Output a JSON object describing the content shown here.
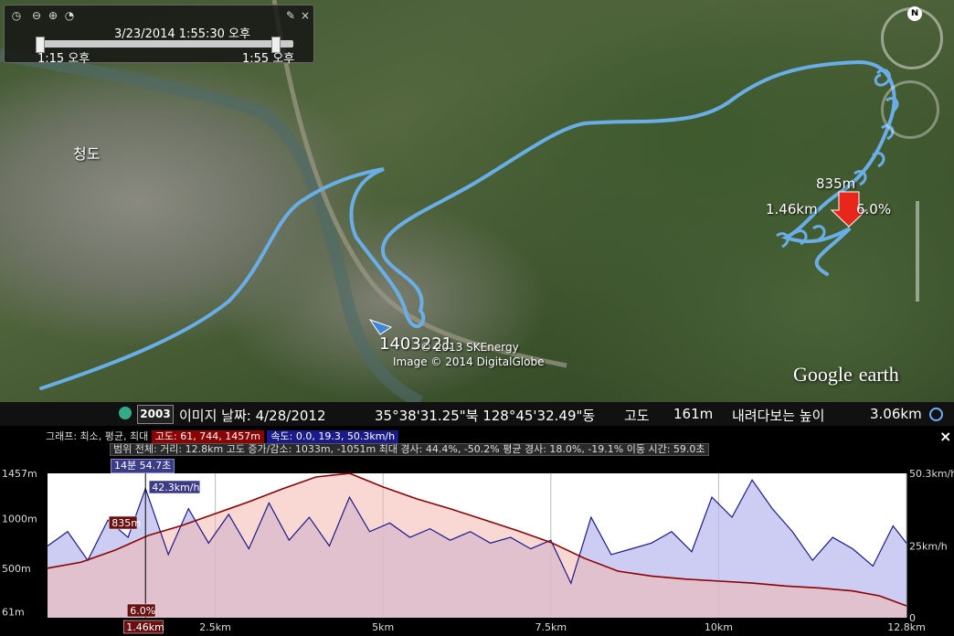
{
  "time_slider": {
    "current": "3/23/2014    1:55:30 오후",
    "start": "1:15 오후",
    "end": "1:55 오후",
    "icons": [
      "clock-icon",
      "zoom-out-icon",
      "zoom-in-icon",
      "settings-icon"
    ]
  },
  "map": {
    "place_label": "청도",
    "marker_elevation": "835m",
    "marker_distance": "1.46km",
    "marker_grade": "6.0%",
    "track_name": "1403221",
    "copyright1": "© 2013 SKEnergy",
    "copyright2": "Image © 2014 DigitalGlobe",
    "track_color": "#5b9bd5",
    "marker_color": "#e8261c",
    "logo_google": "Google",
    "logo_earth": "earth"
  },
  "status_bar": {
    "year": "2003",
    "imagery_date": "이미지 날짜: 4/28/2012",
    "coords": "35°38'31.25\"북 128°45'32.49\"동",
    "elev_label": "고도",
    "elev_value": "161m",
    "eye_label": "내려다보는 높이",
    "eye_value": "3.06km"
  },
  "profile": {
    "legend_prefix": "그래프: 최소, 평균, 최대",
    "legend_elev": "고도: 61, 744, 1457m",
    "legend_speed": "속도: 0.0, 19.3, 50.3km/h",
    "stats": "범위 전체: 거리: 12.8km 고도 증가/감소: 1033m, -1051m 최대 경사: 44.4%, -50.2% 평균 경사: 18.0%, -19.1% 이동 시간: 59.0초",
    "selection_time": "14분 54.7초",
    "close_label": "×",
    "elev_color": "#8b0000",
    "speed_color": "#1a1a8a"
  },
  "chart_data": {
    "type": "area",
    "x_ticks": [
      "2.5km",
      "5km",
      "7.5km",
      "10km",
      "12.8km"
    ],
    "x_tick_values": [
      2.5,
      5,
      7.5,
      10,
      12.8
    ],
    "xlim": [
      0,
      12.8
    ],
    "left_axis_ticks": [
      "1457m",
      "1000m",
      "500m",
      "61m"
    ],
    "left_axis_values": [
      1457,
      1000,
      500,
      61
    ],
    "left_ylim": [
      0,
      1457
    ],
    "right_axis_ticks": [
      "50.3km/h",
      "25km/h",
      "0"
    ],
    "right_axis_values": [
      50.3,
      25,
      0
    ],
    "right_ylim": [
      0,
      50.3
    ],
    "cursor": {
      "x": 1.46,
      "elev_label": "835m",
      "speed_label": "42.3km/h",
      "grade_label": "6.0%",
      "distance_label": "1.46km"
    },
    "series": [
      {
        "name": "고도",
        "unit": "m",
        "x": [
          0,
          0.5,
          1.0,
          1.5,
          2.0,
          2.5,
          3.0,
          3.5,
          4.0,
          4.5,
          5.0,
          5.5,
          6.0,
          6.5,
          7.0,
          7.5,
          8.0,
          8.5,
          9.0,
          9.5,
          10.0,
          10.5,
          11.0,
          11.5,
          12.0,
          12.4,
          12.8
        ],
        "values": [
          500,
          560,
          680,
          830,
          930,
          1050,
          1170,
          1300,
          1420,
          1457,
          1320,
          1200,
          1100,
          990,
          880,
          760,
          600,
          470,
          420,
          390,
          370,
          350,
          320,
          300,
          270,
          220,
          120
        ]
      },
      {
        "name": "속도",
        "unit": "km/h",
        "x": [
          0,
          0.3,
          0.6,
          0.9,
          1.2,
          1.46,
          1.8,
          2.1,
          2.4,
          2.7,
          3.0,
          3.3,
          3.6,
          3.9,
          4.2,
          4.5,
          4.8,
          5.1,
          5.4,
          5.7,
          6.0,
          6.3,
          6.6,
          6.9,
          7.2,
          7.5,
          7.8,
          8.1,
          8.4,
          8.7,
          9.0,
          9.3,
          9.6,
          9.9,
          10.2,
          10.5,
          10.8,
          11.1,
          11.4,
          11.7,
          12.0,
          12.3,
          12.6,
          12.8
        ],
        "values": [
          25,
          30,
          20,
          34,
          28,
          45,
          22,
          38,
          26,
          36,
          24,
          40,
          27,
          35,
          25,
          42,
          30,
          33,
          28,
          31,
          27,
          30,
          26,
          28,
          24,
          27,
          12,
          35,
          22,
          24,
          26,
          30,
          23,
          42,
          35,
          48,
          38,
          30,
          20,
          28,
          24,
          18,
          32,
          26
        ]
      }
    ]
  }
}
